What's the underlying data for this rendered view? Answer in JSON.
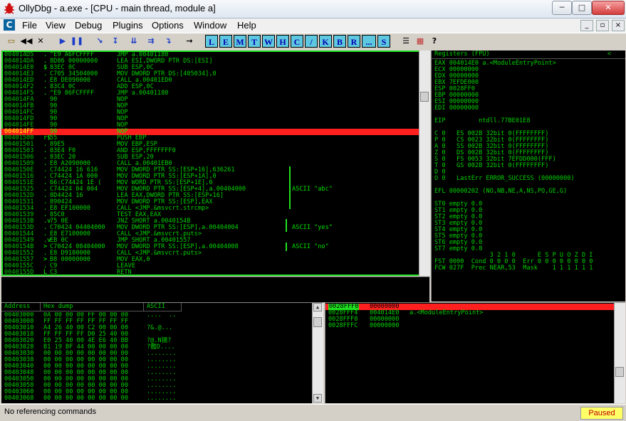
{
  "window": {
    "title": "OllyDbg - a.exe - [CPU - main thread, module a]",
    "minimize": "─",
    "maximize": "□",
    "close": "✕"
  },
  "menu": [
    "File",
    "View",
    "Debug",
    "Plugins",
    "Options",
    "Window",
    "Help"
  ],
  "mdi_icon": "C",
  "mdi_buttons": [
    "_",
    "▫",
    "×"
  ],
  "toolbar": {
    "icons": [
      "open-icon",
      "rewind-icon",
      "close-icon",
      "run-icon",
      "pause-icon",
      "step-into-icon",
      "step-over-icon",
      "trace-into-icon",
      "trace-over-icon",
      "execute-till-return-icon",
      "go-to-icon"
    ],
    "icon_glyphs": [
      "▭",
      "◀◀",
      "✕",
      "▶",
      "❚❚",
      "↘",
      "↧",
      "⇊",
      "⇉",
      "↴",
      "→"
    ],
    "letters": [
      "L",
      "E",
      "M",
      "T",
      "W",
      "H",
      "C",
      "/",
      "K",
      "B",
      "R",
      "...",
      "S"
    ],
    "right_glyphs": [
      "☰",
      "▦",
      "?"
    ]
  },
  "disasm": [
    {
      "addr": "004014D5",
      "g": ".",
      "hex": "^E9 A6FCFFFF",
      "dis": "JMP a.00401180",
      "cmt": ""
    },
    {
      "addr": "004014DA",
      "g": ".",
      "hex": "8D86 00000000",
      "dis": "LEA ESI,DWORD PTR DS:[ESI]",
      "cmt": ""
    },
    {
      "addr": "004014E0",
      "g": "$",
      "hex": "83EC 0C",
      "dis": "SUB ESP,0C",
      "cmt": ""
    },
    {
      "addr": "004014E3",
      "g": ".",
      "hex": "C705 34504000",
      "dis": "MOV DWORD PTR DS:[405034],0",
      "cmt": ""
    },
    {
      "addr": "004014ED",
      "g": ".",
      "hex": "E8 DE090000",
      "dis": "CALL a.00401ED0",
      "cmt": ""
    },
    {
      "addr": "004014F2",
      "g": ".",
      "hex": "83C4 0C",
      "dis": "ADD ESP,0C",
      "cmt": ""
    },
    {
      "addr": "004014F5",
      "g": ".",
      "hex": "^E9 86FCFFFF",
      "dis": "JMP a.00401180",
      "cmt": ""
    },
    {
      "addr": "004014FA",
      "g": "",
      "hex": "90",
      "dis": "NOP",
      "cmt": ""
    },
    {
      "addr": "004014FB",
      "g": "",
      "hex": "90",
      "dis": "NOP",
      "cmt": ""
    },
    {
      "addr": "004014FC",
      "g": "",
      "hex": "90",
      "dis": "NOP",
      "cmt": ""
    },
    {
      "addr": "004014FD",
      "g": "",
      "hex": "90",
      "dis": "NOP",
      "cmt": ""
    },
    {
      "addr": "004014FE",
      "g": "",
      "hex": "90",
      "dis": "NOP",
      "cmt": ""
    },
    {
      "addr": "004014FF",
      "g": "",
      "hex": "90",
      "dis": "NOP",
      "cmt": ""
    },
    {
      "addr": "00401500",
      "g": "r$",
      "hex": "55",
      "dis": "PUSH EBP",
      "cmt": ""
    },
    {
      "addr": "00401501",
      "g": ".",
      "hex": "89E5",
      "dis": "MOV EBP,ESP",
      "cmt": ""
    },
    {
      "addr": "00401503",
      "g": ".",
      "hex": "83E4 F0",
      "dis": "AND ESP,FFFFFFF0",
      "cmt": ""
    },
    {
      "addr": "00401506",
      "g": ".",
      "hex": "83EC 20",
      "dis": "SUB ESP,20",
      "cmt": ""
    },
    {
      "addr": "00401509",
      "g": ".",
      "hex": "E8 A2090000",
      "dis": "CALL a.00401EB0",
      "cmt": ""
    },
    {
      "addr": "0040150E",
      "g": ".",
      "hex": "C74424 16 616",
      "dis": "MOV DWORD PTR SS:[ESP+16],636261",
      "cmt": ""
    },
    {
      "addr": "00401516",
      "g": ".",
      "hex": "C74424 1A 000",
      "dis": "MOV DWORD PTR SS:[ESP+1A],0",
      "cmt": ""
    },
    {
      "addr": "0040151E",
      "g": ".",
      "hex": "66:C74424 1E (",
      "dis": "MOV WORD PTR SS:[ESP+1E],0",
      "cmt": ""
    },
    {
      "addr": "00401525",
      "g": ".",
      "hex": "C74424 04 004",
      "dis": "MOV DWORD PTR SS:[ESP+4],a.00404000",
      "cmt": "ASCII \"abc\""
    },
    {
      "addr": "0040152D",
      "g": ".",
      "hex": "8D4424 16",
      "dis": "LEA EAX,DWORD PTR SS:[ESP+16]",
      "cmt": ""
    },
    {
      "addr": "00401531",
      "g": ".",
      "hex": "890424",
      "dis": "MOV DWORD PTR SS:[ESP],EAX",
      "cmt": ""
    },
    {
      "addr": "00401534",
      "g": ".",
      "hex": "E8 EF100000",
      "dis": "CALL <JMP.&msvcrt.strcmp>",
      "cmt": ""
    },
    {
      "addr": "00401539",
      "g": ".",
      "hex": "85C0",
      "dis": "TEST EAX,EAX",
      "cmt": ""
    },
    {
      "addr": "0040153B",
      "g": ".v",
      "hex": "75 0E",
      "dis": "JNZ SHORT a.0040154B",
      "cmt": ""
    },
    {
      "addr": "0040153D",
      "g": ".",
      "hex": "C70424 04404000",
      "dis": "MOV DWORD PTR SS:[ESP],a.00404004",
      "cmt": "ASCII \"yes\""
    },
    {
      "addr": "00401544",
      "g": ".",
      "hex": "E8 E7100000",
      "dis": "CALL <JMP.&msvcrt.puts>",
      "cmt": ""
    },
    {
      "addr": "00401549",
      "g": ".v",
      "hex": "EB 0C",
      "dis": "JMP SHORT a.00401557",
      "cmt": ""
    },
    {
      "addr": "0040154B",
      "g": ">",
      "hex": "C70424 08404000",
      "dis": "MOV DWORD PTR SS:[ESP],a.00404008",
      "cmt": "ASCII \"no\""
    },
    {
      "addr": "00401552",
      "g": ".",
      "hex": "E8 D9100000",
      "dis": "CALL <JMP.&msvcrt.puts>",
      "cmt": ""
    },
    {
      "addr": "00401557",
      "g": ">",
      "hex": "B8 00000000",
      "dis": "MOV EAX,0",
      "cmt": ""
    },
    {
      "addr": "0040155C",
      "g": ".",
      "hex": "C9",
      "dis": "LEAVE",
      "cmt": ""
    },
    {
      "addr": "0040155D",
      "g": "L",
      "hex": "C3",
      "dis": "RETN",
      "cmt": ""
    }
  ],
  "registers": {
    "header": "Registers (FPU)",
    "collapse": "<",
    "lines": [
      "EAX 004014E0 a.<ModuleEntryPoint>",
      "ECX 00000000",
      "EDX 00000000",
      "EBX 7EFDE000",
      "ESP 0028FF0",
      "EBP 00000000",
      "ESI 00000000",
      "EDI 00000000",
      "",
      "EIP         ntdll.77BE01E8",
      "",
      "C 0   ES 002B 32bit 0(FFFFFFFF)",
      "P 0   CS 0023 32bit 0(FFFFFFFF)",
      "A 0   SS 002B 32bit 0(FFFFFFFF)",
      "Z 0   DS 002B 32bit 0(FFFFFFFF)",
      "S 0   FS 0053 32bit 7EFDD000(FFF)",
      "T 0   GS 002B 32bit 0(FFFFFFFF)",
      "D 0",
      "O 0   LastErr ERROR_SUCCESS (00000000)",
      "",
      "EFL 00000202 (NO,NB,NE,A,NS,PO,GE,G)",
      "",
      "ST0 empty 0.0",
      "ST1 empty 0.0",
      "ST2 empty 0.0",
      "ST3 empty 0.0",
      "ST4 empty 0.0",
      "ST5 empty 0.0",
      "ST6 empty 0.0",
      "ST7 empty 0.0",
      "               3 2 1 0      E S P U O Z D I",
      "FST 0000  Cond 0 0 0 0  Err 0 0 0 0 0 0 0 0",
      "FCW 027F  Prec NEAR,53  Mask    1 1 1 1 1 1"
    ]
  },
  "dump": {
    "headers": [
      "Address",
      "Hex dump",
      "ASCII"
    ],
    "rows": [
      {
        "addr": "00403000",
        "hex": "0A 00 00 00 FF 00 00 00",
        "ascii": "....  .."
      },
      {
        "addr": "00403008",
        "hex": "FF FF FF FF FF FF FF FF",
        "ascii": ""
      },
      {
        "addr": "00403010",
        "hex": "A4 26 40 00 C2 00 00 00",
        "ascii": "?&.@..."
      },
      {
        "addr": "00403018",
        "hex": "FF FF FF FF D0 25 40 00",
        "ascii": ""
      },
      {
        "addr": "00403020",
        "hex": "E0 25 40 00 4E E6 40 BB",
        "ascii": "?@.N揚?"
      },
      {
        "addr": "00403028",
        "hex": "B1 19 BF 44 00 00 00 00",
        "ascii": "?鑑D...."
      },
      {
        "addr": "00403030",
        "hex": "00 00 00 00 00 00 00 00",
        "ascii": "........"
      },
      {
        "addr": "00403038",
        "hex": "00 00 00 00 00 00 00 00",
        "ascii": "........"
      },
      {
        "addr": "00403040",
        "hex": "00 00 00 00 00 00 00 00",
        "ascii": "........"
      },
      {
        "addr": "00403048",
        "hex": "00 00 00 00 00 00 00 00",
        "ascii": "........"
      },
      {
        "addr": "00403050",
        "hex": "00 00 00 00 00 00 00 00",
        "ascii": "........"
      },
      {
        "addr": "00403058",
        "hex": "00 00 00 00 00 00 00 00",
        "ascii": "........"
      },
      {
        "addr": "00403060",
        "hex": "00 00 00 00 00 00 00 00",
        "ascii": "........"
      },
      {
        "addr": "00403068",
        "hex": "00 00 00 00 00 00 00 00",
        "ascii": "........"
      }
    ]
  },
  "stack": [
    {
      "addr": "0028FFF0",
      "val": "00000000",
      "cmt": ""
    },
    {
      "addr": "0028FFF4",
      "val": "004014E0",
      "cmt": "a.<ModuleEntryPoint>"
    },
    {
      "addr": "0028FFF8",
      "val": "00000000",
      "cmt": ""
    },
    {
      "addr": "0028FFFC",
      "val": "00000000",
      "cmt": ""
    }
  ],
  "status": {
    "message": "No referencing commands",
    "state": "Paused"
  },
  "colors": {
    "accent_green": "#20e020",
    "selection_red": "#ff1f1f",
    "paused_bg": "#ffff66"
  }
}
